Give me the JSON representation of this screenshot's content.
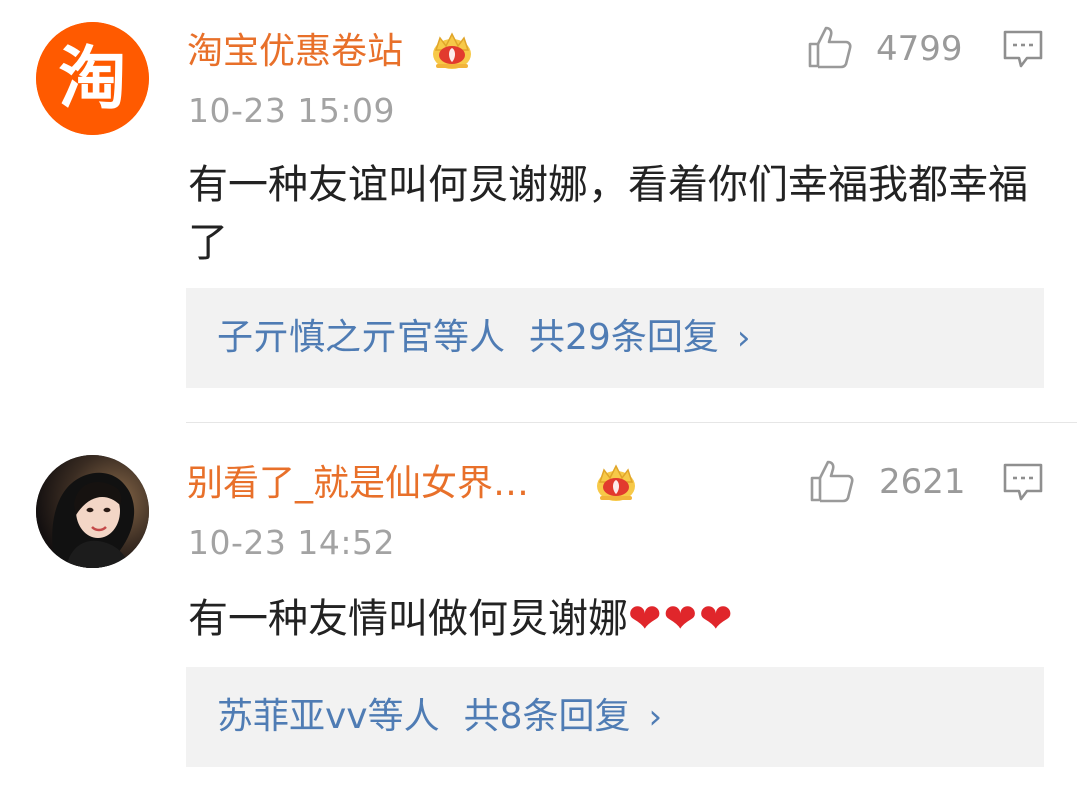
{
  "comments": [
    {
      "author": "淘宝优惠卷站",
      "avatar_icon": "taobao-logo-icon",
      "avatar_text": "淘",
      "badge_icon": "crown-icon",
      "time": "10-23 15:09",
      "likes": "4799",
      "content": "有一种友谊叫何炅谢娜，看着你们幸福我都幸福了",
      "reply": {
        "names": "子亓慎之亓官",
        "suffix": "等人",
        "count": "共29条回复",
        "arrow": "›"
      }
    },
    {
      "author": "别看了_就是仙女界…",
      "avatar_icon": "user-avatar",
      "badge_icon": "crown-icon",
      "time": "10-23 14:52",
      "likes": "2621",
      "content": "有一种友情叫做何炅谢娜",
      "hearts": "❤❤❤",
      "reply": {
        "names": "苏菲亚vv",
        "suffix": "等人",
        "count": "共8条回复",
        "arrow": "›"
      }
    }
  ],
  "colors": {
    "author": "#e8702a",
    "link": "#4f7cb4",
    "time": "#a3a3a3",
    "taobao_orange": "#ff5a00",
    "heart": "#e0262b"
  }
}
